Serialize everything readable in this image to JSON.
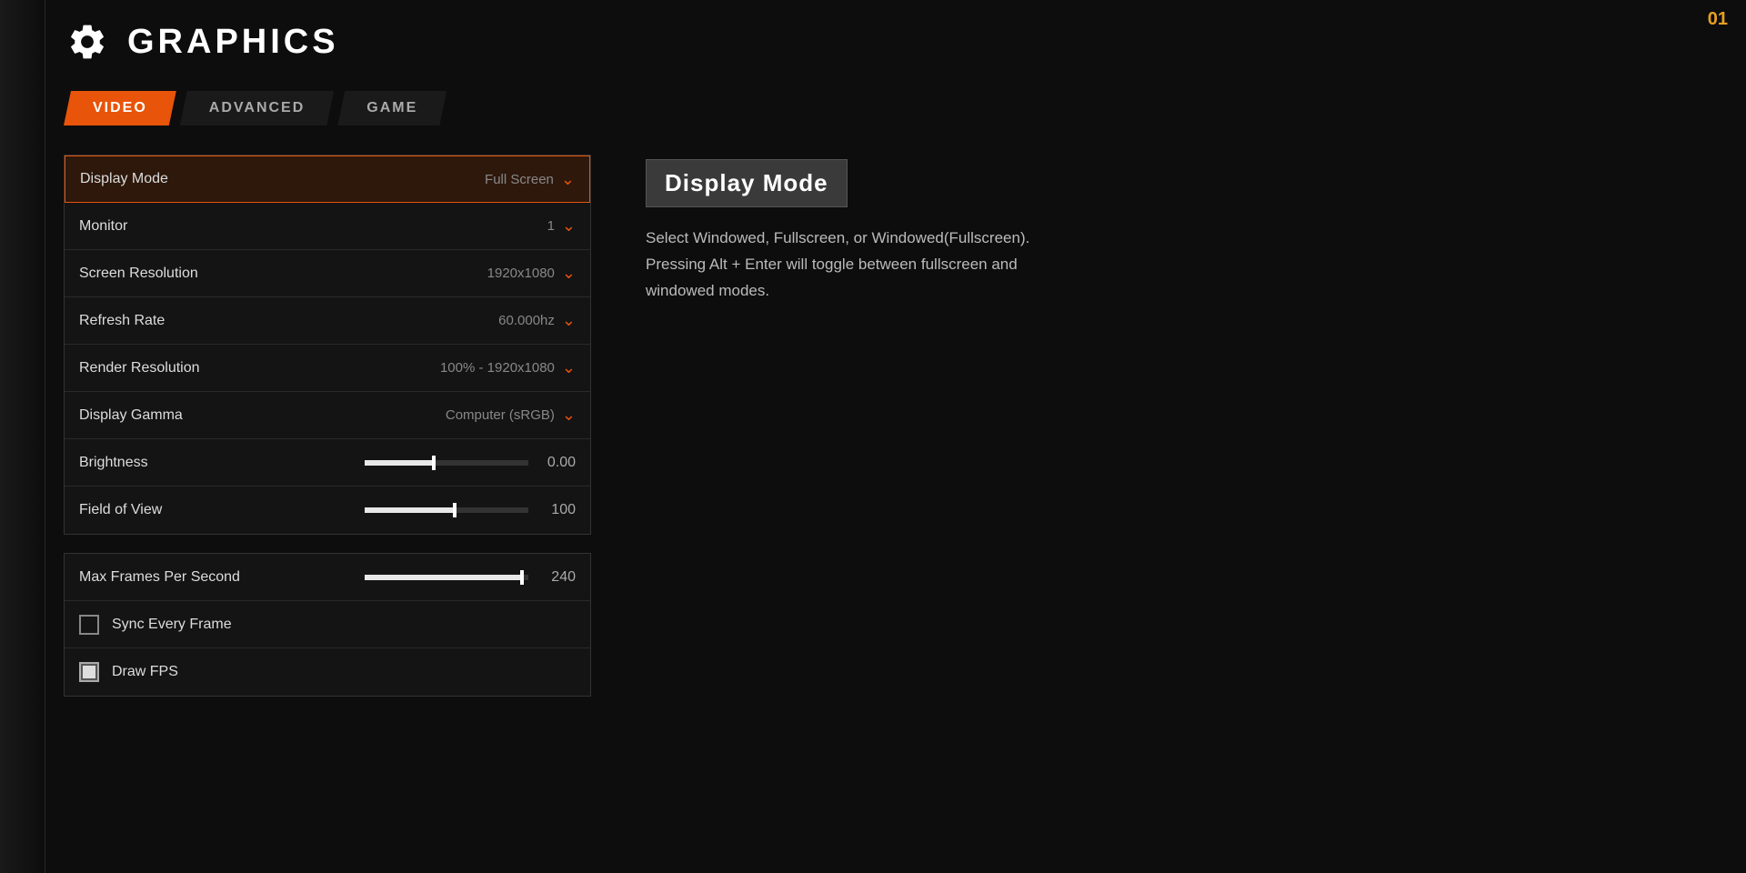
{
  "header": {
    "title": "GRAPHICS",
    "icon": "gear"
  },
  "tabs": [
    {
      "id": "video",
      "label": "VIDEO",
      "active": true
    },
    {
      "id": "advanced",
      "label": "ADVANCED",
      "active": false
    },
    {
      "id": "game",
      "label": "GAME",
      "active": false
    }
  ],
  "settings_group_1": {
    "rows": [
      {
        "id": "display-mode",
        "label": "Display Mode",
        "value": "Full Screen",
        "type": "dropdown",
        "highlighted": true
      },
      {
        "id": "monitor",
        "label": "Monitor",
        "value": "1",
        "type": "dropdown"
      },
      {
        "id": "screen-resolution",
        "label": "Screen Resolution",
        "value": "1920x1080",
        "type": "dropdown"
      },
      {
        "id": "refresh-rate",
        "label": "Refresh Rate",
        "value": "60.000hz",
        "type": "dropdown"
      },
      {
        "id": "render-resolution",
        "label": "Render Resolution",
        "value": "100% - 1920x1080",
        "type": "dropdown"
      },
      {
        "id": "display-gamma",
        "label": "Display Gamma",
        "value": "Computer (sRGB)",
        "type": "dropdown"
      },
      {
        "id": "brightness",
        "label": "Brightness",
        "value": "0.00",
        "type": "slider",
        "fill_pct": 42
      },
      {
        "id": "field-of-view",
        "label": "Field of View",
        "value": "100",
        "type": "slider",
        "fill_pct": 55
      }
    ]
  },
  "settings_group_2": {
    "rows": [
      {
        "id": "max-fps",
        "label": "Max Frames Per Second",
        "value": "240",
        "type": "slider",
        "fill_pct": 96
      },
      {
        "id": "sync-every-frame",
        "label": "Sync Every Frame",
        "type": "checkbox",
        "checked": false
      },
      {
        "id": "draw-fps",
        "label": "Draw FPS",
        "type": "checkbox",
        "checked": true
      }
    ]
  },
  "info_panel": {
    "title": "Display Mode",
    "description": "Select Windowed, Fullscreen, or Windowed(Fullscreen). Pressing Alt + Enter will toggle between fullscreen and windowed modes."
  },
  "corner": {
    "value": "01"
  }
}
